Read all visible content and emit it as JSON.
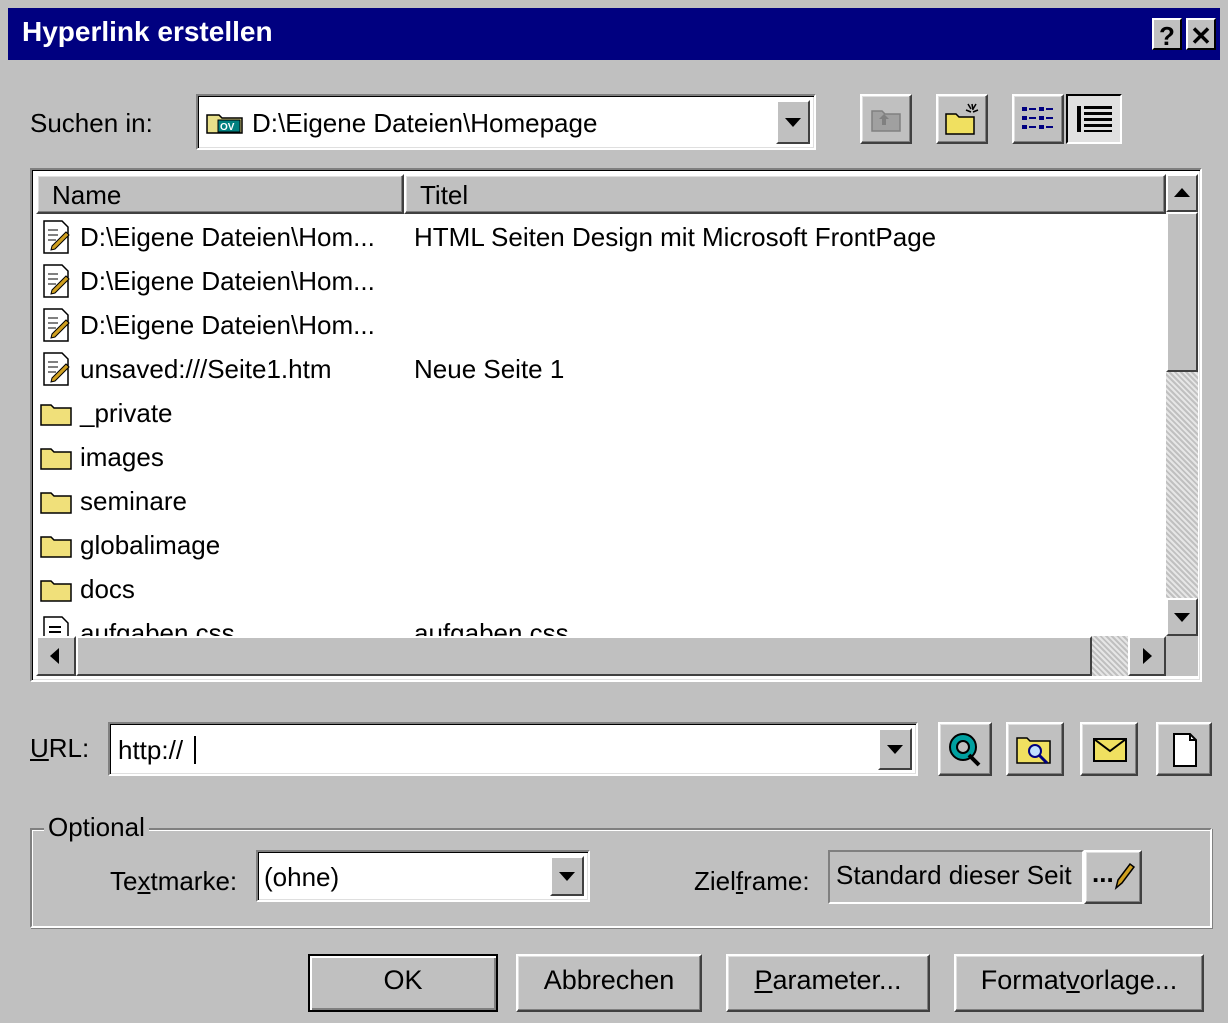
{
  "window": {
    "title": "Hyperlink erstellen",
    "help_glyph": "?",
    "close_glyph": "✕"
  },
  "lookin": {
    "label": "Suchen in:",
    "path": "D:\\Eigene Dateien\\Homepage"
  },
  "list": {
    "columns": [
      "Name",
      "Titel"
    ],
    "rows": [
      {
        "icon": "html-page-icon",
        "name": "D:\\Eigene Dateien\\Hom...",
        "titel": "HTML Seiten Design mit Microsoft FrontPage"
      },
      {
        "icon": "html-page-icon",
        "name": "D:\\Eigene Dateien\\Hom...",
        "titel": ""
      },
      {
        "icon": "html-page-icon",
        "name": "D:\\Eigene Dateien\\Hom...",
        "titel": ""
      },
      {
        "icon": "html-page-icon",
        "name": "unsaved:///Seite1.htm",
        "titel": "Neue Seite 1"
      },
      {
        "icon": "folder-icon",
        "name": "_private",
        "titel": ""
      },
      {
        "icon": "folder-icon",
        "name": "images",
        "titel": ""
      },
      {
        "icon": "folder-icon",
        "name": "seminare",
        "titel": ""
      },
      {
        "icon": "folder-icon",
        "name": "globalimage",
        "titel": ""
      },
      {
        "icon": "folder-icon",
        "name": "docs",
        "titel": ""
      },
      {
        "icon": "css-file-icon",
        "name": "aufgaben.css",
        "titel": "aufgaben.css"
      }
    ]
  },
  "url": {
    "label_u": "U",
    "label_rest": "RL:",
    "value": "http://"
  },
  "optional": {
    "group_label": "Optional",
    "textmarke_a": "Te",
    "textmarke_u": "x",
    "textmarke_b": "tmarke:",
    "textmarke_value": "(ohne)",
    "zielframe_a": "Ziel",
    "zielframe_u": "f",
    "zielframe_b": "rame:",
    "zielframe_value": "Standard dieser Seit",
    "zielframe_button": "..."
  },
  "buttons": {
    "ok": "OK",
    "cancel": "Abbrechen",
    "params_u": "P",
    "params_rest": "arameter...",
    "style_a": "Format",
    "style_u": "v",
    "style_b": "orlage..."
  }
}
